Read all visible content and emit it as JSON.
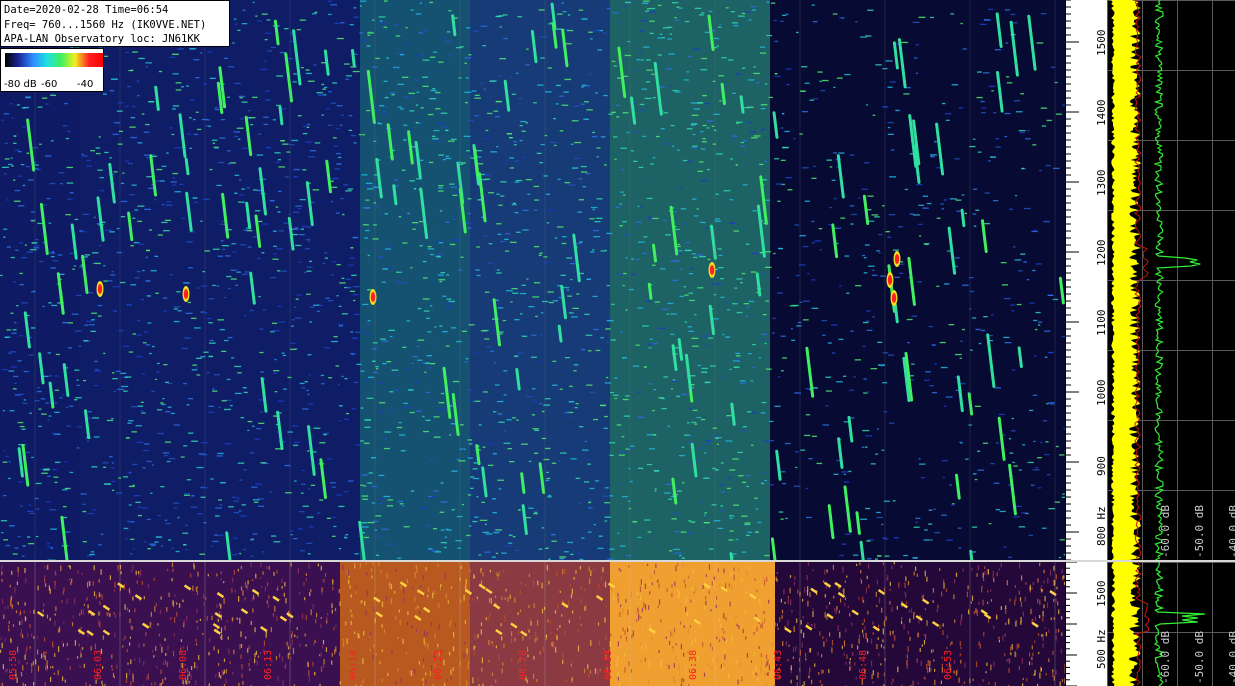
{
  "header": {
    "date_line": "Date=2020-02-28 Time=06:54",
    "freq_line": "Freq= 760...1560 Hz (IK0VVE.NET)",
    "loc_line": "APA-LAN Observatory loc: JN61KK"
  },
  "legend": {
    "labels": [
      "-80 dB",
      "-60",
      "-40"
    ],
    "gradient_colors": [
      "#000000",
      "#1a2a9a",
      "#2f8cff",
      "#20e0e0",
      "#40f060",
      "#f0f020",
      "#ff2020",
      "#ff0000"
    ]
  },
  "freq_axis_top": {
    "labels": [
      "1500",
      "1400",
      "1300",
      "1200",
      "1100",
      "1000",
      "900",
      "800 Hz"
    ],
    "hz": [
      1500,
      1400,
      1300,
      1200,
      1100,
      1000,
      900,
      800
    ],
    "range_hz": [
      760,
      1560
    ]
  },
  "freq_axis_bottom": {
    "labels": [
      "1500",
      "500 Hz"
    ],
    "hz": [
      1500,
      500
    ],
    "range_hz": [
      0,
      2000
    ]
  },
  "spectrum_top": {
    "db_labels": [
      "-60.0 dB",
      "-50.0 dB",
      "-40.0 dB"
    ],
    "db_values": [
      -60,
      -50,
      -40
    ],
    "trace_colors": {
      "avg": "#ffff00",
      "peak": "#33ee33",
      "ref": "#cc1010"
    }
  },
  "spectrum_bottom": {
    "db_labels": [
      "-60.0 dB",
      "-50.0 dB",
      "-40.0 dB"
    ],
    "db_values": [
      -60,
      -50,
      -40
    ]
  },
  "time_labels": [
    "05:58",
    "06:03",
    "06:08",
    "06:13",
    "06:18",
    "06:23",
    "06:28",
    "06:33",
    "06:38",
    "06:43",
    "06:48",
    "06:53"
  ],
  "colors": {
    "wf_bg": "#0a0f3a",
    "wf_bottom_bg": "#2a0a3a",
    "time_label": "#ff2020",
    "grid": "#7a7a7a"
  }
}
